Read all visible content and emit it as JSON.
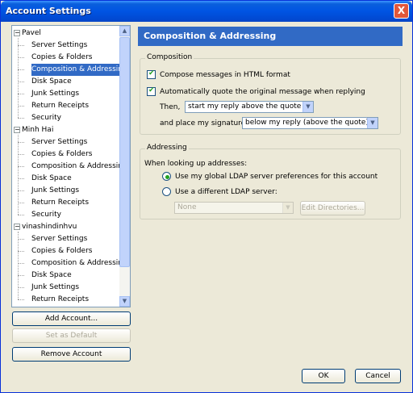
{
  "window": {
    "title": "Account Settings",
    "close_glyph": "X"
  },
  "tree": {
    "accounts": [
      {
        "name": "Pavel",
        "expander": "−",
        "items": [
          "Server Settings",
          "Copies & Folders",
          "Composition & Addressing",
          "Disk Space",
          "Junk Settings",
          "Return Receipts",
          "Security"
        ]
      },
      {
        "name": "Minh Hai",
        "expander": "−",
        "items": [
          "Server Settings",
          "Copies & Folders",
          "Composition & Addressing",
          "Disk Space",
          "Junk Settings",
          "Return Receipts",
          "Security"
        ]
      },
      {
        "name": "vinashindinhvu",
        "expander": "−",
        "items": [
          "Server Settings",
          "Copies & Folders",
          "Composition & Addressing",
          "Disk Space",
          "Junk Settings",
          "Return Receipts"
        ]
      }
    ],
    "selected": "Pavel / Composition & Addressing"
  },
  "left_buttons": {
    "add_account": "Add Account...",
    "set_default": "Set as Default",
    "remove_account": "Remove Account"
  },
  "panel": {
    "header": "Composition & Addressing",
    "composition": {
      "legend": "Composition",
      "html_format_label": "Compose messages in HTML format",
      "html_format_checked": true,
      "quote_label": "Automatically quote the original message when replying",
      "quote_checked": true,
      "then_label": "Then,",
      "then_value": "start my reply above the quote",
      "signature_label": "and place my signature",
      "signature_value": "below my reply (above the quote)"
    },
    "addressing": {
      "legend": "Addressing",
      "intro": "When looking up addresses:",
      "option_global": "Use my global LDAP server preferences for this account",
      "option_different": "Use a different LDAP server:",
      "selected_option": "global",
      "server_value": "None",
      "edit_directories": "Edit Directories..."
    }
  },
  "footer": {
    "ok": "OK",
    "cancel": "Cancel"
  },
  "icons": {
    "close": "close-icon",
    "scroll_up": "chevron-up-icon",
    "scroll_down": "chevron-down-icon",
    "dropdown": "chevron-down-icon"
  },
  "colors": {
    "title_blue": "#0054e3",
    "selection": "#316ac5",
    "dialog_bg": "#ece9d8",
    "check_green": "#21a121"
  }
}
